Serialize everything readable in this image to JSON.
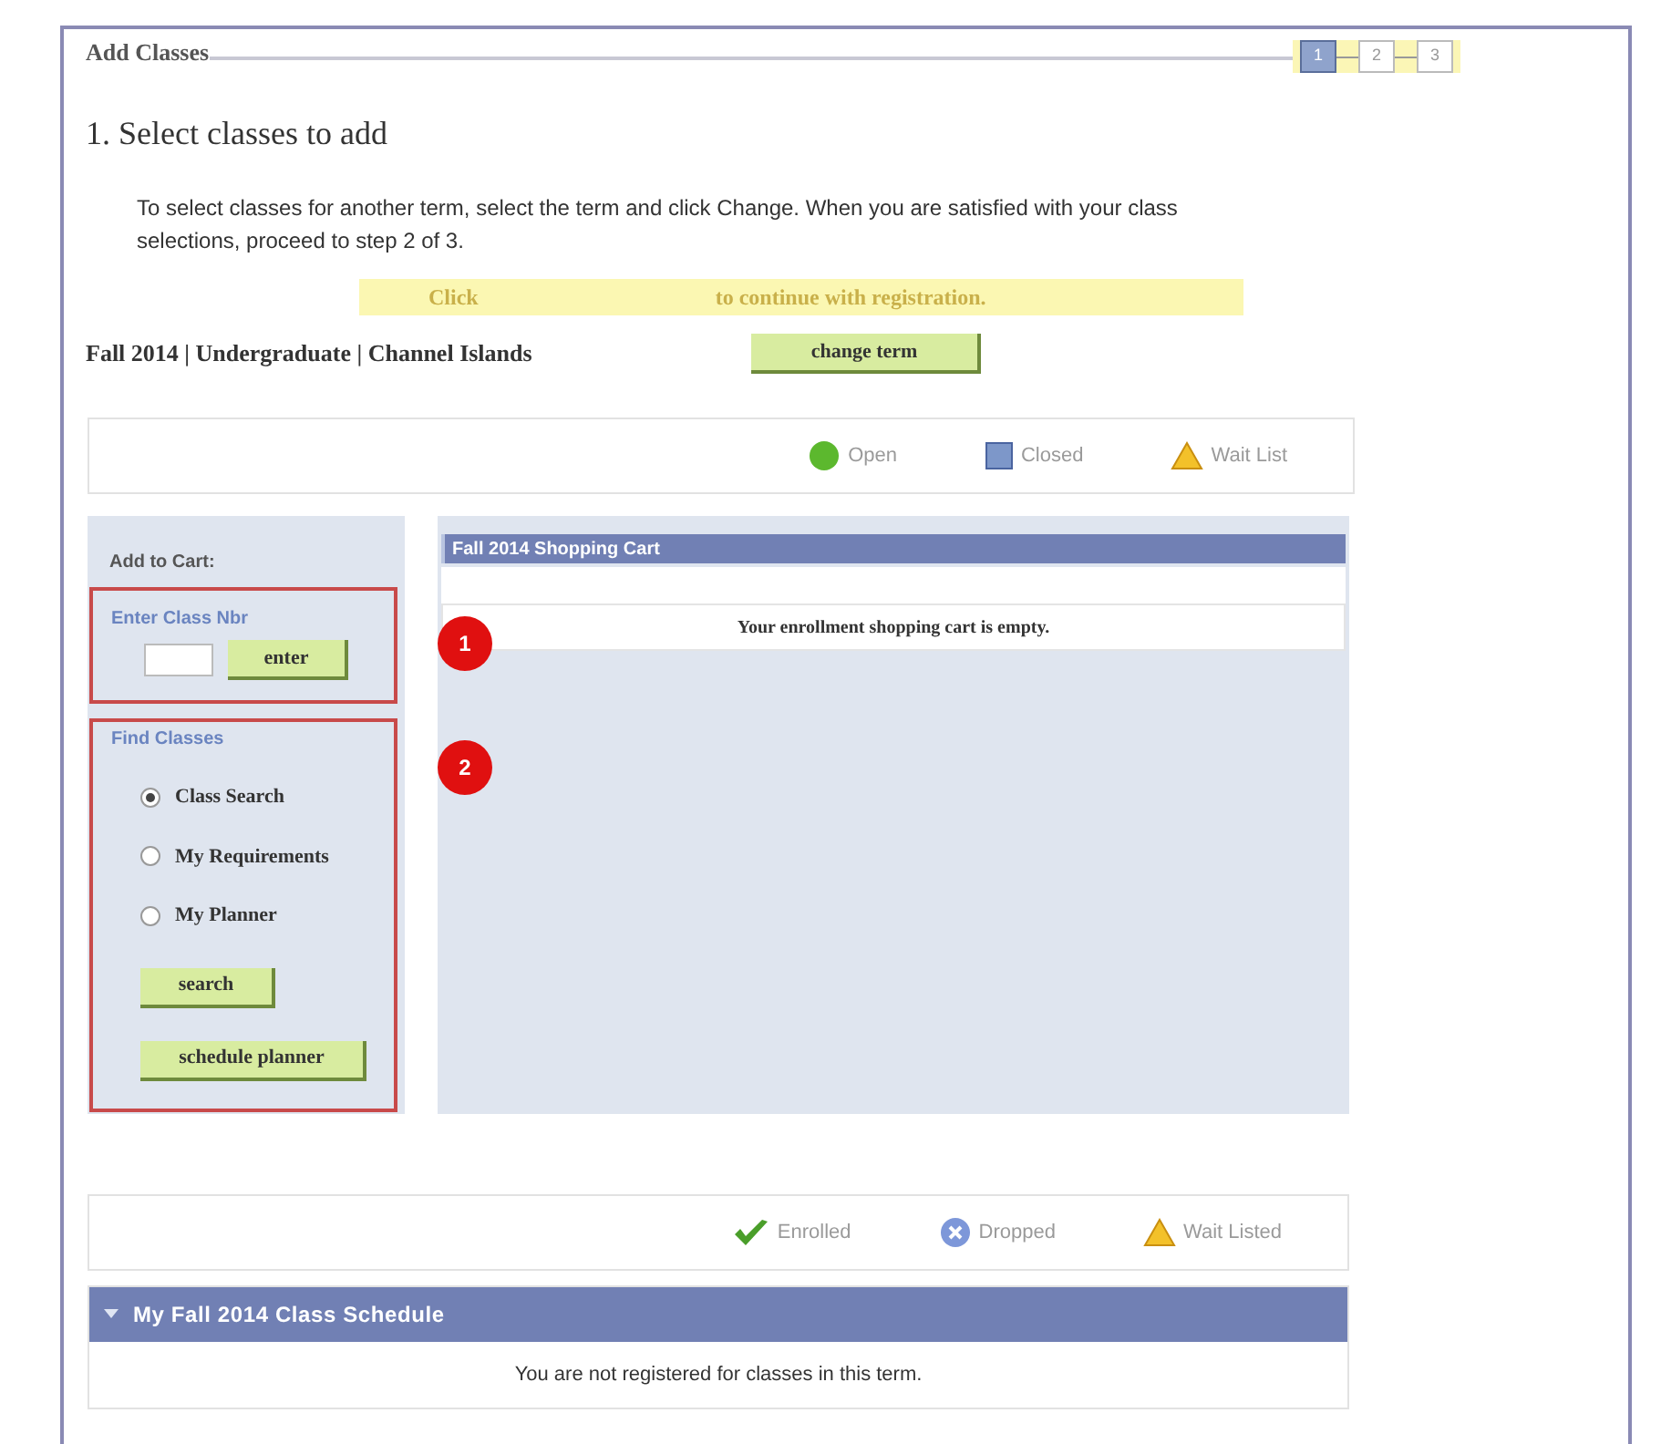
{
  "header": {
    "title": "Add Classes",
    "steps": [
      {
        "label": "1",
        "selected": true
      },
      {
        "label": "2",
        "selected": false
      },
      {
        "label": "3",
        "selected": false
      }
    ]
  },
  "step_title": "1. Select classes to add",
  "instructions": "To select classes for another term, select the term and click Change.  When you are satisfied with your class selections, proceed to step 2 of 3.",
  "banner": {
    "before": "Click",
    "after": "to continue with registration."
  },
  "term": {
    "label": "Fall 2014 | Undergraduate | Channel Islands",
    "button": "change term"
  },
  "class_legend": [
    {
      "kind": "open",
      "label": "Open"
    },
    {
      "kind": "closed",
      "label": "Closed"
    },
    {
      "kind": "waitlist",
      "label": "Wait List"
    }
  ],
  "add_to_cart": {
    "title": "Add to Cart:",
    "class_nbr": {
      "label": "Enter Class Nbr",
      "button": "enter",
      "callout": "1"
    },
    "find": {
      "label": "Find Classes",
      "options": [
        {
          "label": "Class Search",
          "selected": true
        },
        {
          "label": "My Requirements",
          "selected": false
        },
        {
          "label": "My Planner",
          "selected": false
        }
      ],
      "buttons": [
        "search",
        "schedule planner"
      ],
      "callout": "2"
    }
  },
  "cart": {
    "title": "Fall 2014 Shopping Cart",
    "message": "Your enrollment shopping cart is empty."
  },
  "status_legend": [
    {
      "kind": "enrolled",
      "label": "Enrolled"
    },
    {
      "kind": "dropped",
      "label": "Dropped"
    },
    {
      "kind": "waitlist",
      "label": "Wait Listed"
    }
  ],
  "schedule": {
    "title": "My Fall 2014 Class Schedule",
    "expanded": true,
    "message": "You are not registered for classes in this term."
  }
}
